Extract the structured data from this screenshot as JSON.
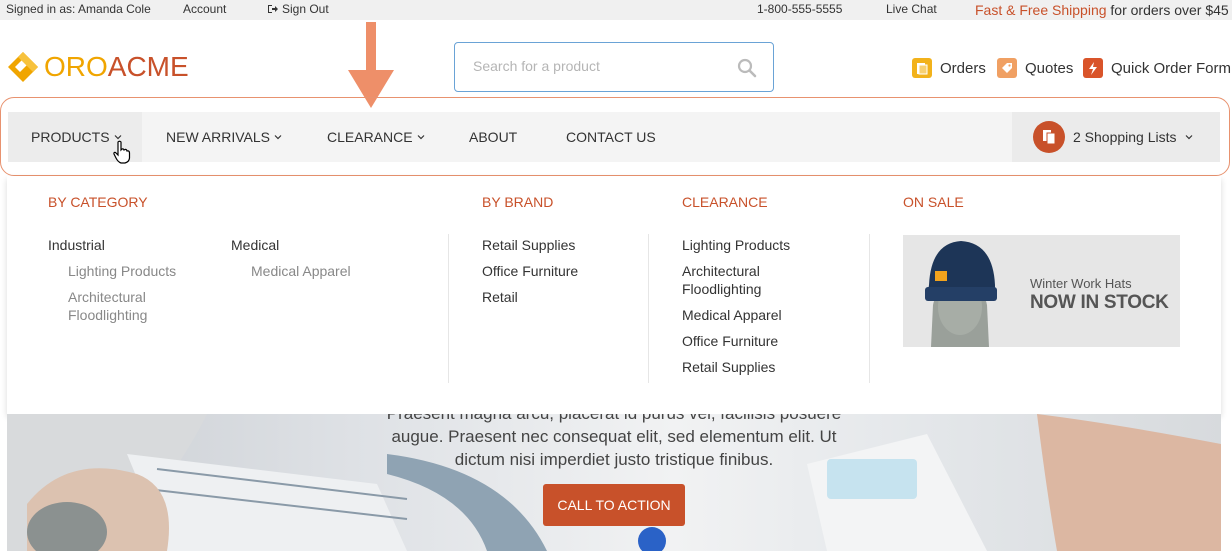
{
  "topbar": {
    "signed_in": "Signed in as: Amanda Cole",
    "account": "Account",
    "sign_out": "Sign Out",
    "phone": "1-800-555-5555",
    "live_chat": "Live Chat",
    "shipping_highlight": "Fast & Free Shipping",
    "shipping_rest": " for orders over $45"
  },
  "header": {
    "logo_oro": "ORO",
    "logo_acme": "ACME",
    "search_placeholder": "Search for a product",
    "orders": "Orders",
    "quotes": "Quotes",
    "quick_order": "Quick Order Form"
  },
  "nav": {
    "products": "PRODUCTS",
    "new_arrivals": "NEW ARRIVALS",
    "clearance": "CLEARANCE",
    "about": "ABOUT",
    "contact": "CONTACT US",
    "shopping_lists": "2 Shopping Lists"
  },
  "mega": {
    "by_category": {
      "title": "BY CATEGORY",
      "industrial": "Industrial",
      "industrial_items": [
        "Lighting Products",
        "Architectural Floodlighting"
      ],
      "medical": "Medical",
      "medical_items": [
        "Medical Apparel"
      ]
    },
    "by_brand": {
      "title": "BY BRAND",
      "items": [
        "Retail Supplies",
        "Office Furniture",
        "Retail"
      ]
    },
    "clearance": {
      "title": "CLEARANCE",
      "items": [
        "Lighting Products",
        "Architectural Floodlighting",
        "Medical Apparel",
        "Office Furniture",
        "Retail Supplies"
      ]
    },
    "on_sale": {
      "title": "ON SALE",
      "banner_line1": "Winter Work Hats",
      "banner_line2": "NOW IN STOCK"
    }
  },
  "hero": {
    "line0": "Praesent magna arcu, placerat id purus vel, facilisis posuere",
    "line1": "augue. Praesent nec consequat elit, sed elementum elit. Ut",
    "line2": "dictum nisi imperdiet justo tristique finibus.",
    "cta": "CALL TO ACTION"
  },
  "colors": {
    "accent": "#c8512a",
    "logo_yellow": "#f0a500",
    "search_border": "#6aa3d6",
    "annotation": "#e8926f"
  }
}
